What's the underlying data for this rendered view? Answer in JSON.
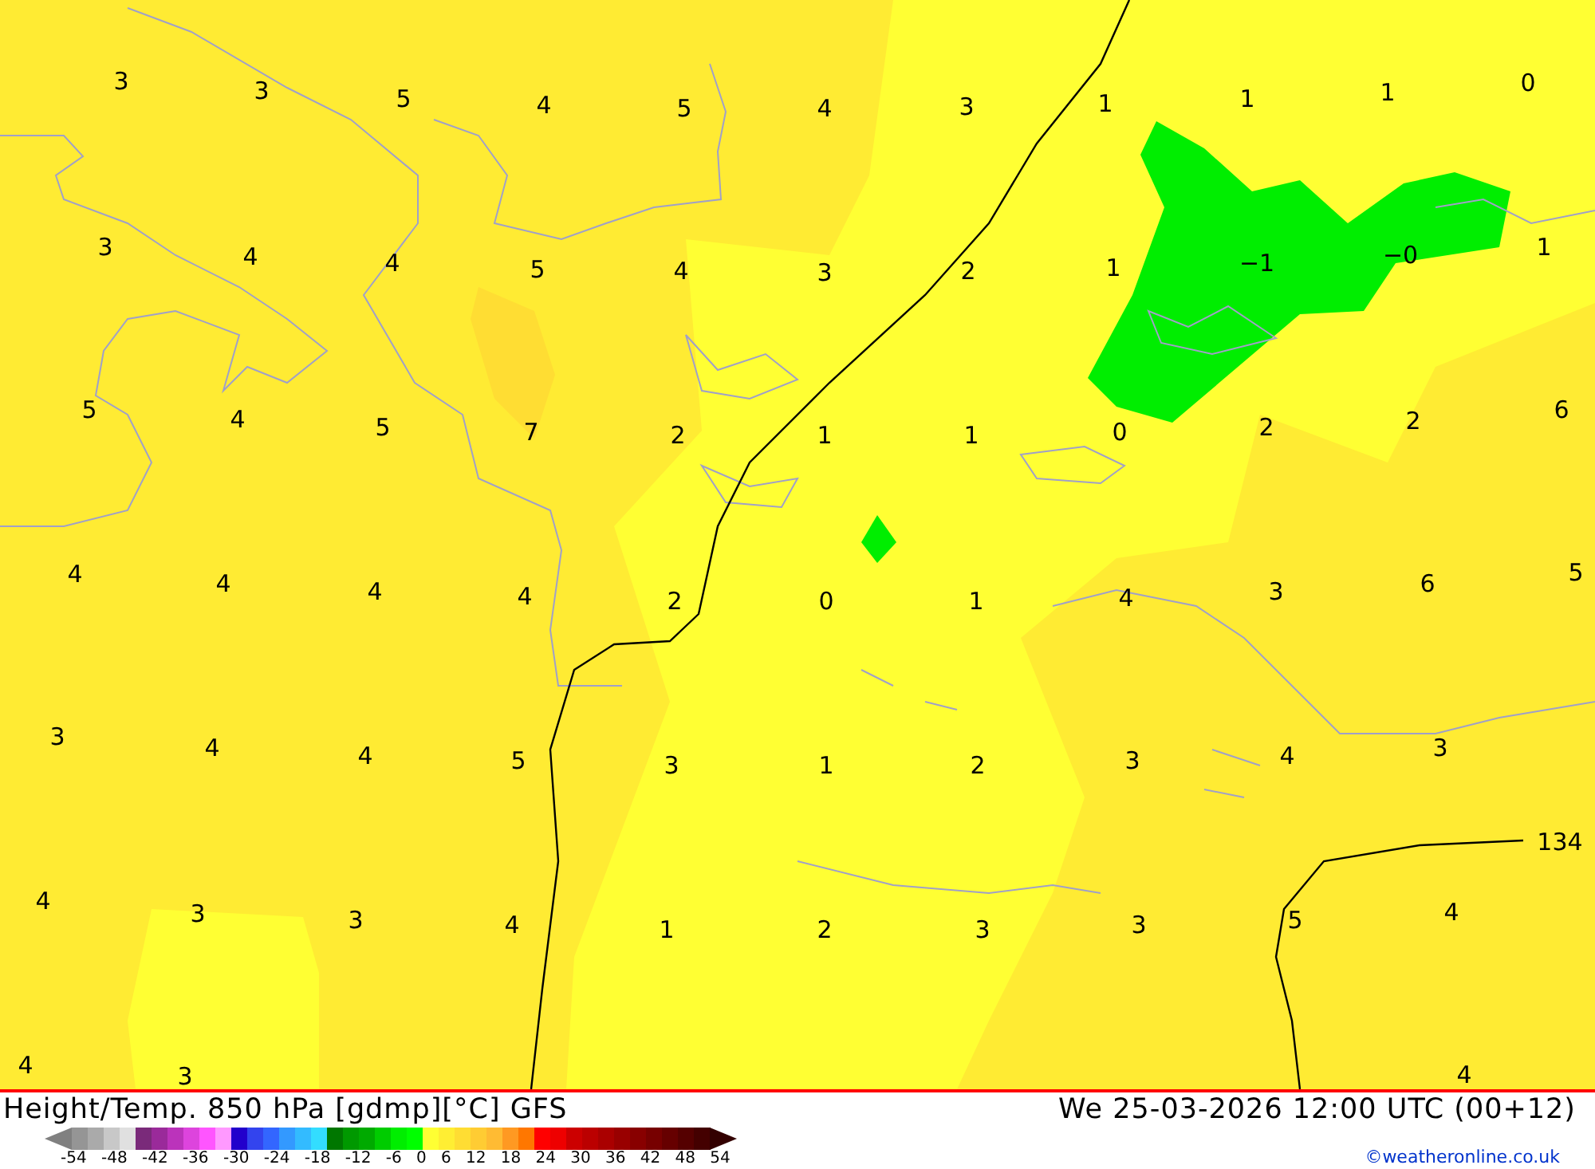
{
  "map": {
    "label_rows": [
      [
        "3",
        "3",
        "5",
        "4",
        "5",
        "4",
        "3",
        "1",
        "1",
        "1",
        "0"
      ],
      [
        "3",
        "4",
        "4",
        "5",
        "4",
        "3",
        "2",
        "1",
        "−1",
        "−0",
        "1"
      ],
      [
        "5",
        "4",
        "5",
        "7",
        "2",
        "1",
        "1",
        "0",
        "2",
        "2",
        "6"
      ],
      [
        "4",
        "4",
        "4",
        "4",
        "2",
        "0",
        "1",
        "4",
        "3",
        "6",
        "5"
      ],
      [
        "3",
        "4",
        "4",
        "5",
        "3",
        "1",
        "2",
        "3",
        "4",
        "3"
      ],
      [
        "4",
        "3",
        "3",
        "4",
        "1",
        "2",
        "3",
        "3",
        "5",
        "4"
      ],
      [
        "4",
        "3",
        "4"
      ]
    ],
    "contour_label": "134"
  },
  "footer": {
    "title": "Height/Temp. 850 hPa [gdmp][°C] GFS",
    "datetime": "We 25-03-2026 12:00 UTC (00+12)",
    "scale_ticks": [
      "-54",
      "-48",
      "-42",
      "-36",
      "-30",
      "-24",
      "-18",
      "-12",
      "-6",
      "0",
      "6",
      "12",
      "18",
      "24",
      "30",
      "36",
      "42",
      "48",
      "54"
    ],
    "credit": "©weatheronline.co.uk"
  }
}
